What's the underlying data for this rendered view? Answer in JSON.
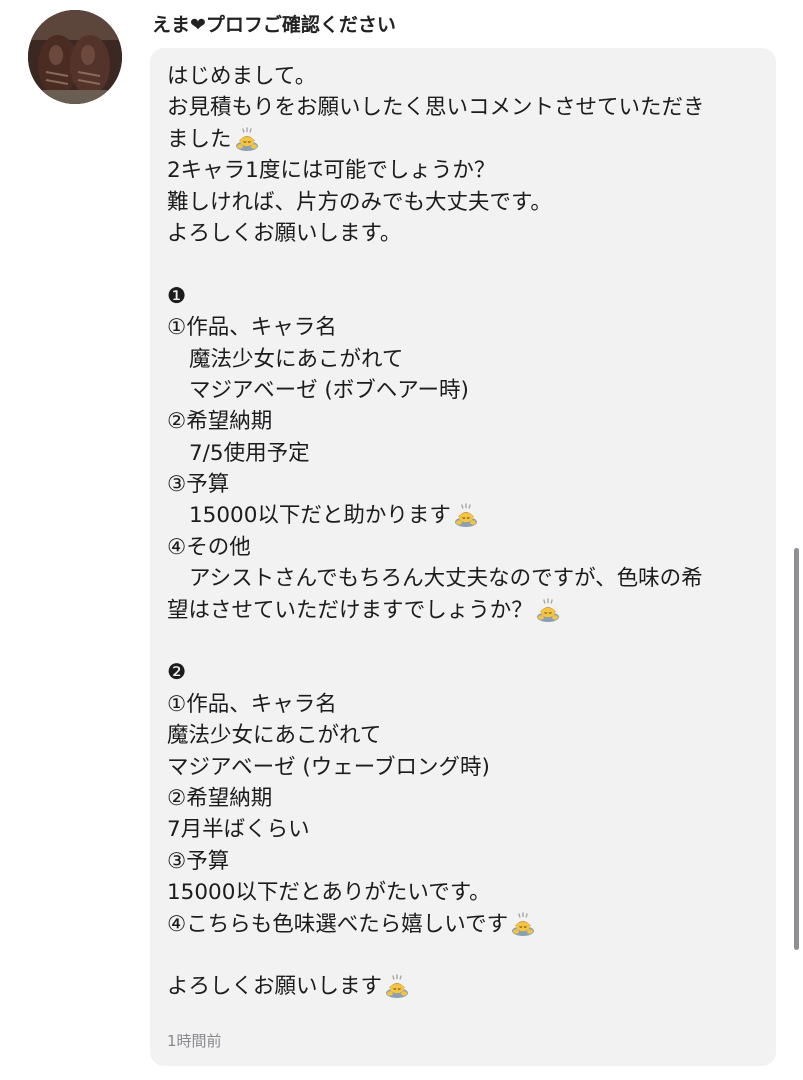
{
  "comment": {
    "username": "えま❤プロフご確認ください",
    "timestamp": "1時間前",
    "avatar_icon": "boots-photo-icon",
    "bow_emoji": "person-bowing-emoji",
    "lines": [
      {
        "text": "はじめまして。"
      },
      {
        "text": "お見積もりをお願いしたく思いコメントさせていただき"
      },
      {
        "text": "ました",
        "emoji": true
      },
      {
        "text": "2キャラ1度には可能でしょうか？"
      },
      {
        "text": "難しければ、片方のみでも大丈夫です。"
      },
      {
        "text": "よろしくお願いします。"
      },
      {
        "text": ""
      },
      {
        "text": "❶"
      },
      {
        "text": "①作品、キャラ名"
      },
      {
        "text": "魔法少女にあこがれて",
        "indent": true
      },
      {
        "text": "マジアベーゼ (ボブヘアー時)",
        "indent": true
      },
      {
        "text": "②希望納期"
      },
      {
        "text": "7/5使用予定",
        "indent": true
      },
      {
        "text": "③予算"
      },
      {
        "text": "15000以下だと助かります",
        "indent": true,
        "emoji": true
      },
      {
        "text": "④その他"
      },
      {
        "text": "アシストさんでもちろん大丈夫なのですが、色味の希",
        "indent": true
      },
      {
        "text": "望はさせていただけますでしょうか？",
        "emoji": true
      },
      {
        "text": ""
      },
      {
        "text": "❷"
      },
      {
        "text": "①作品、キャラ名"
      },
      {
        "text": "魔法少女にあこがれて"
      },
      {
        "text": "マジアベーゼ (ウェーブロング時)"
      },
      {
        "text": "②希望納期"
      },
      {
        "text": "7月半ばくらい"
      },
      {
        "text": "③予算"
      },
      {
        "text": "15000以下だとありがたいです。"
      },
      {
        "text": "④こちらも色味選べたら嬉しいです",
        "emoji": true
      },
      {
        "text": ""
      },
      {
        "text": "よろしくお願いします",
        "emoji": true
      }
    ]
  }
}
